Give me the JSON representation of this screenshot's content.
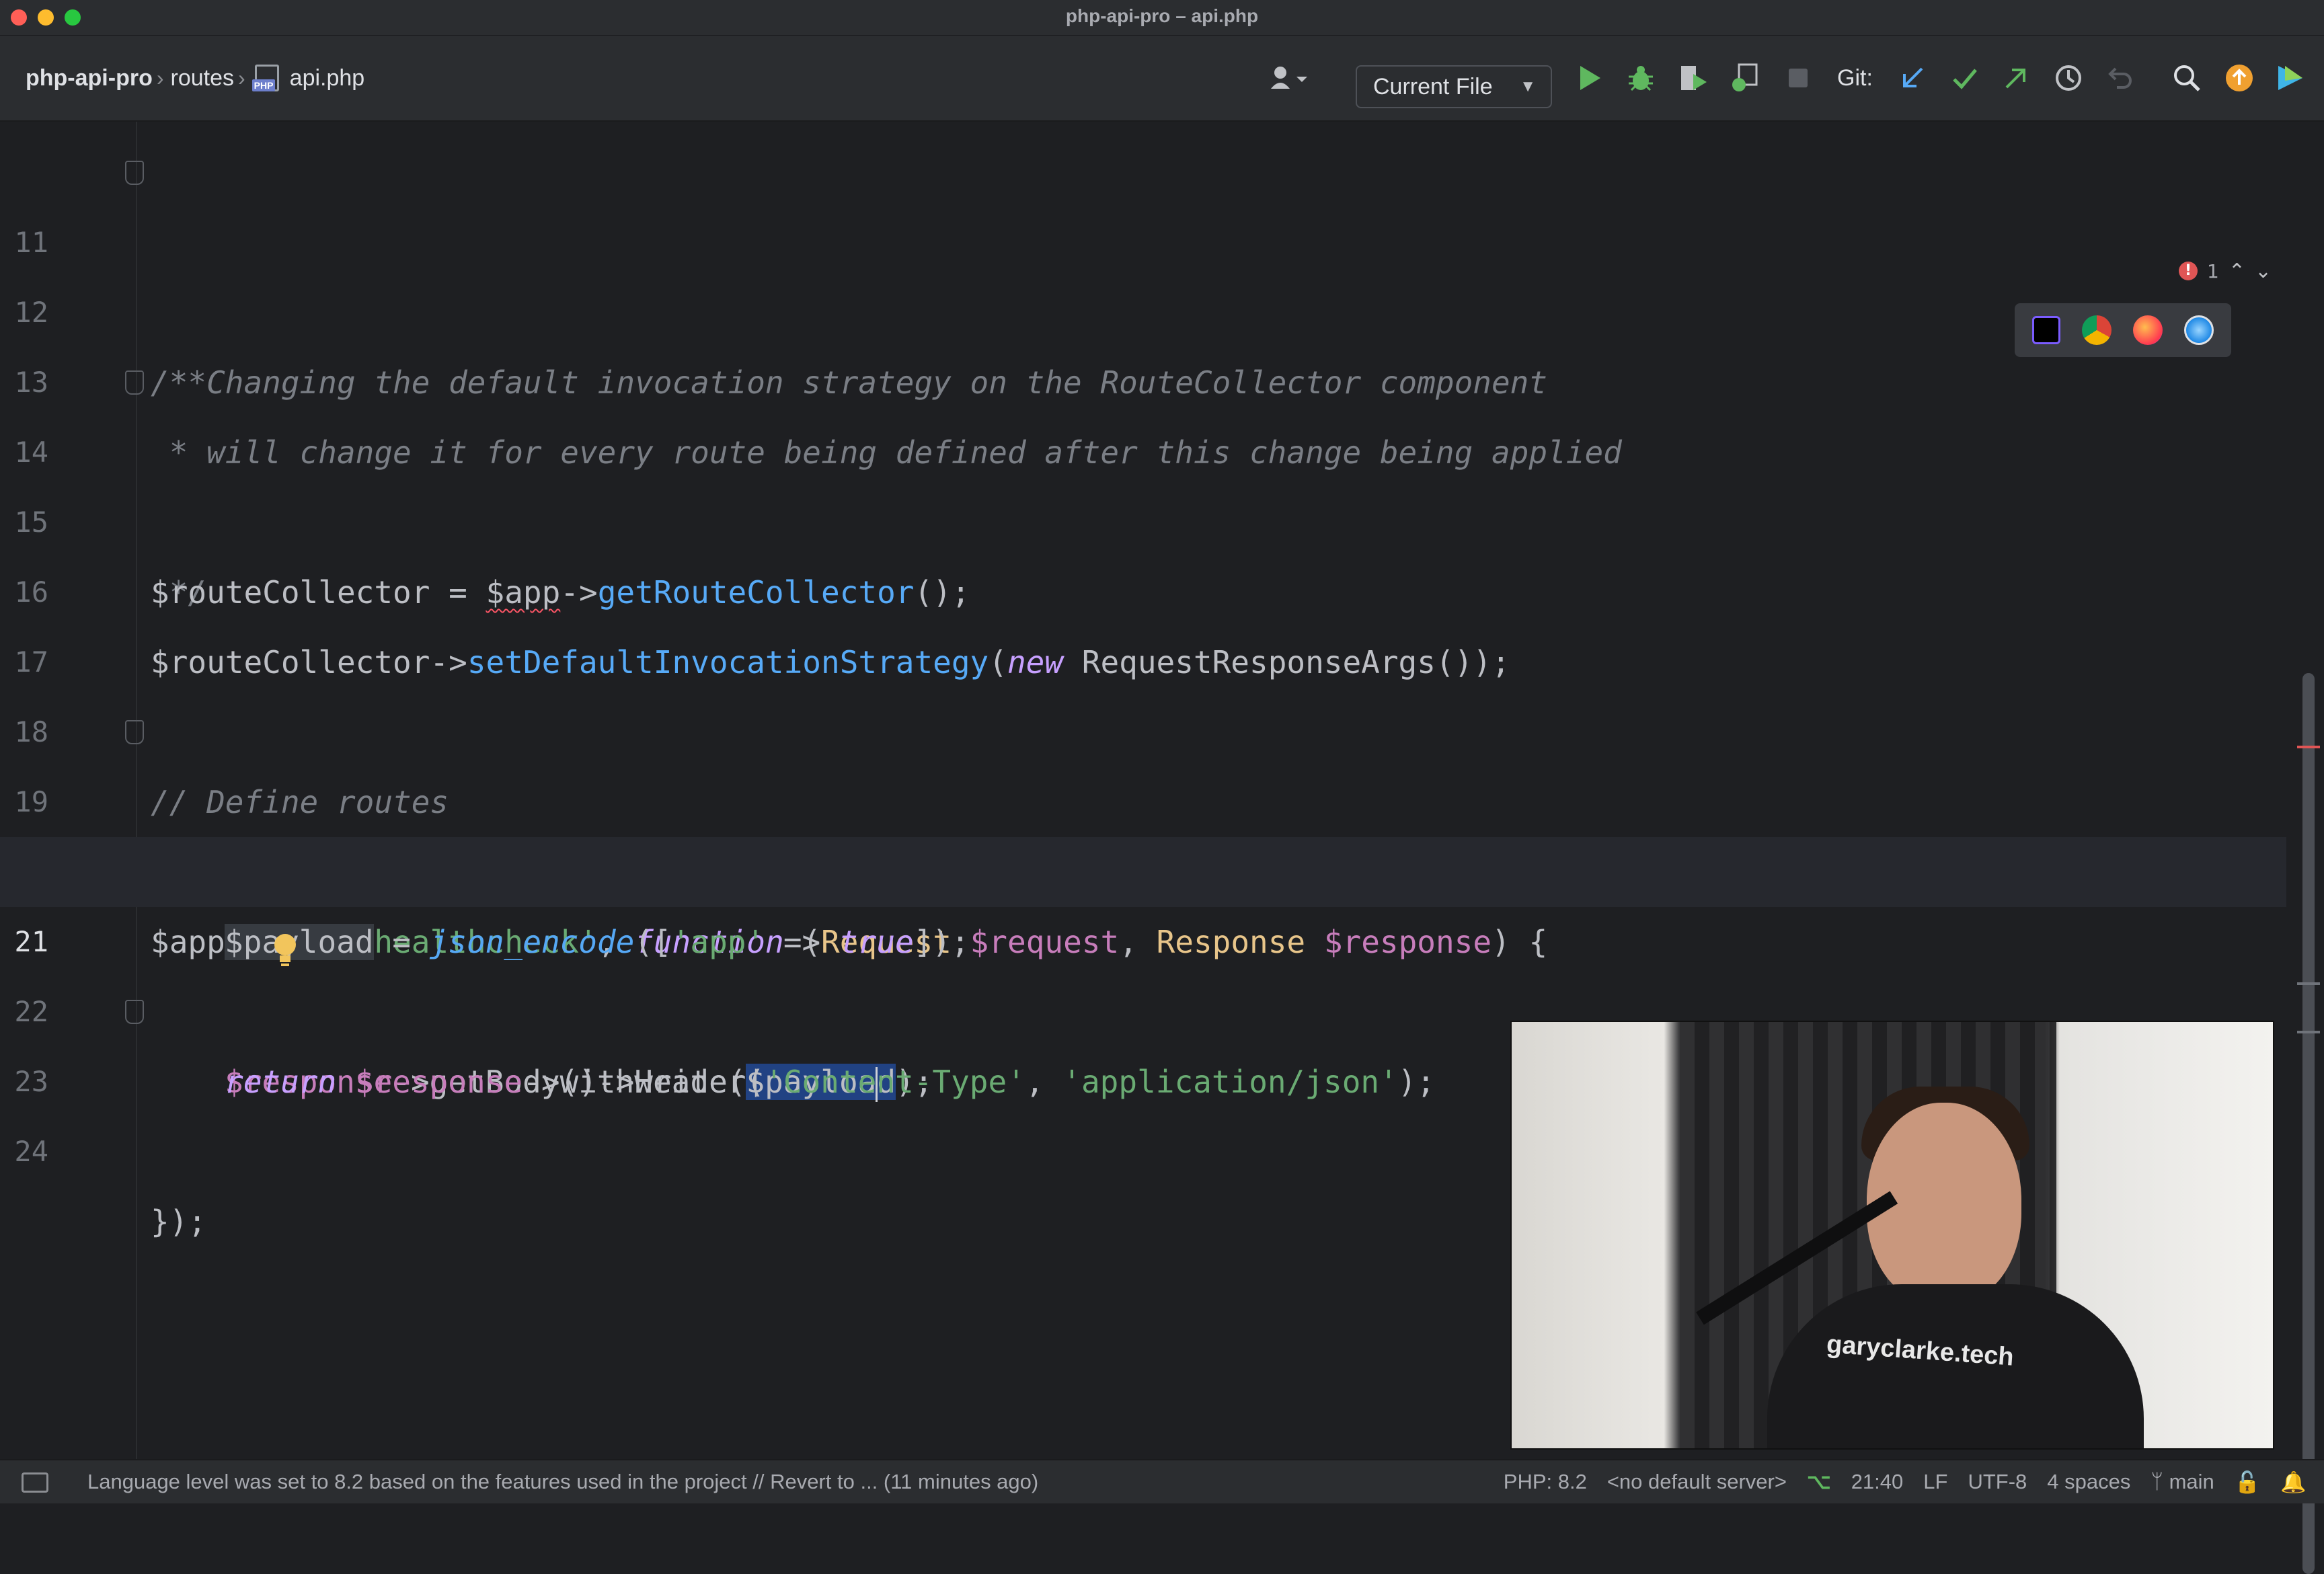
{
  "window": {
    "title": "php-api-pro – api.php"
  },
  "breadcrumb": {
    "project": "php-api-pro",
    "folder": "routes",
    "file": "api.php",
    "file_tag": "PHP"
  },
  "toolbar": {
    "run_config": "Current File",
    "git_label": "Git:",
    "icons": [
      "user-icon",
      "run-icon",
      "debug-icon",
      "coverage-icon",
      "profile-icon",
      "stop-icon",
      "git-update-icon",
      "git-commit-icon",
      "git-push-icon",
      "history-icon",
      "rollback-icon",
      "search-icon",
      "updates-icon",
      "jetbrains-ai-icon"
    ]
  },
  "inspections": {
    "error_count": "1"
  },
  "editor": {
    "current_line": 21,
    "lines": [
      {
        "n": "11"
      },
      {
        "n": "12"
      },
      {
        "n": "13"
      },
      {
        "n": "14"
      },
      {
        "n": "15"
      },
      {
        "n": "16"
      },
      {
        "n": "17"
      },
      {
        "n": "18"
      },
      {
        "n": "19"
      },
      {
        "n": "20"
      },
      {
        "n": "21"
      },
      {
        "n": "22"
      },
      {
        "n": "23"
      },
      {
        "n": "24"
      }
    ],
    "tokens": {
      "l11": "/**",
      "l12": " * Changing the default invocation strategy on the RouteCollector component",
      "l13": " * will change it for every route being defined after this change being applied",
      "l14": " */",
      "l15_a": "$routeCollector",
      "l15_b": " = ",
      "l15_c": "$app",
      "l15_d": "->",
      "l15_e": "getRouteCollector",
      "l15_f": "();",
      "l16_a": "$routeCollector",
      "l16_b": "->",
      "l16_c": "setDefaultInvocationStrategy",
      "l16_d": "(",
      "l16_e": "new",
      "l16_f": " RequestResponseArgs",
      "l16_g": "());",
      "l18": "// Define routes",
      "l19_a": "$app",
      "l19_b": "->",
      "l19_c": "get",
      "l19_d": "(",
      "l19_e": "'/healthcheck'",
      "l19_f": ", ",
      "l19_g": "function",
      "l19_h": " (",
      "l19_i": "Request",
      "l19_j": " $request",
      "l19_k": ", ",
      "l19_l": "Response",
      "l19_m": " $response",
      "l19_n": ") {",
      "l20_a": "$payload",
      "l20_b": " = ",
      "l20_c": "json_encode",
      "l20_d": "([",
      "l20_e": "'app'",
      "l20_f": " => ",
      "l20_g": "true",
      "l20_h": "]);",
      "l21_a": "$response",
      "l21_b": "->",
      "l21_c": "getBody",
      "l21_d": "()->",
      "l21_e": "write",
      "l21_f": "(",
      "l21_g1": "$paylo",
      "l21_g2": "a",
      "l21_g3": "d",
      "l21_h": ");",
      "l22_a": "return",
      "l22_b": " $response",
      "l22_c": "->",
      "l22_d": "withHeader",
      "l22_e": "(",
      "l22_f": "'Content-Type'",
      "l22_g": ", ",
      "l22_h": "'application/json'",
      "l22_i": ");",
      "l23": "});"
    }
  },
  "webcam": {
    "shirt_text": "garyclarke.tech"
  },
  "statusbar": {
    "message": "Language level was set to 8.2 based on the features used in the project // Revert to ... (11 minutes ago)",
    "php_version": "PHP: 8.2",
    "server": "<no default server>",
    "position": "21:40",
    "line_ending": "LF",
    "encoding": "UTF-8",
    "indent": "4 spaces",
    "branch": "main"
  },
  "colors": {
    "accent": "#57aaf7",
    "error": "#e05555",
    "run": "#5fb85f"
  }
}
